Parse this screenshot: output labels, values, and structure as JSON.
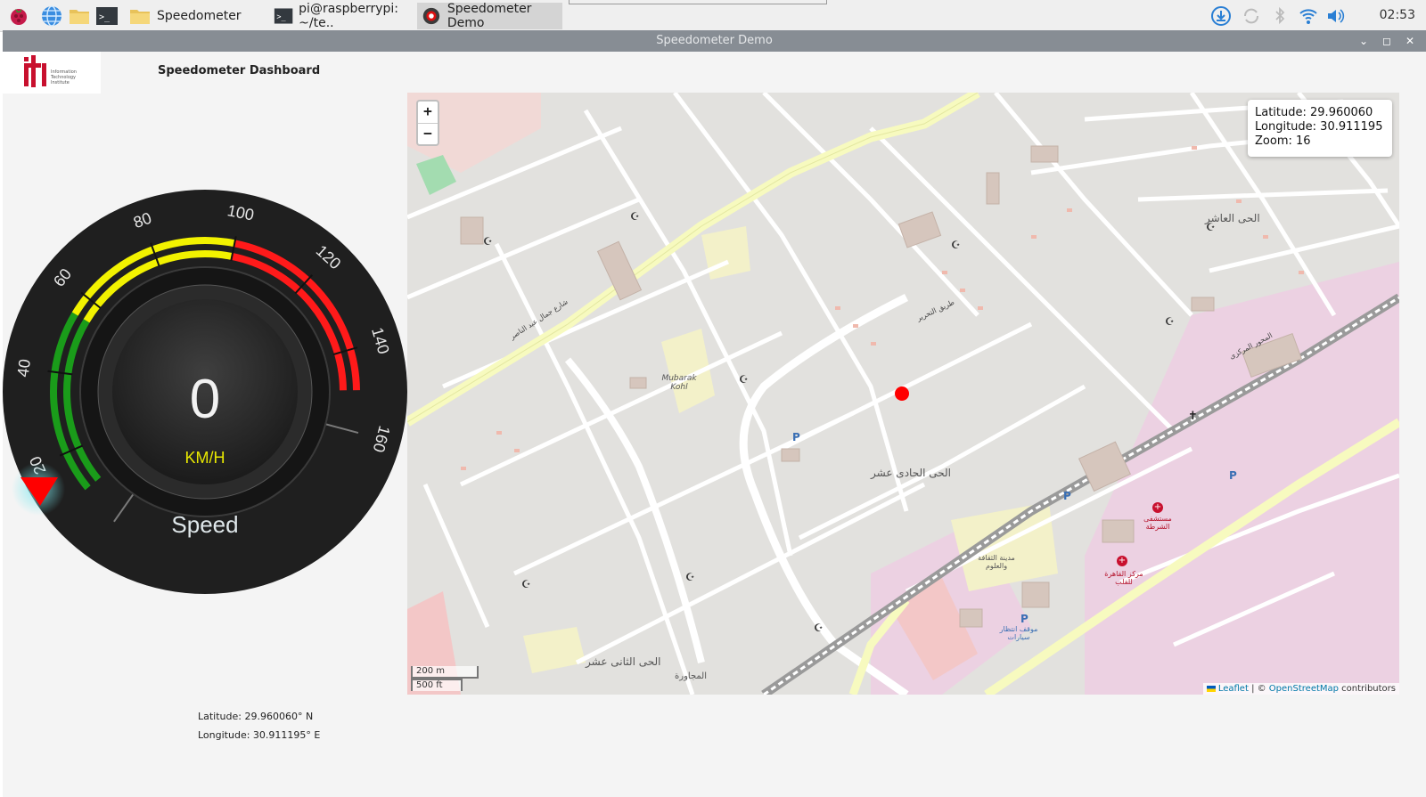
{
  "taskbar": {
    "tasks": [
      {
        "label": "Speedometer",
        "icon": "folder-icon"
      },
      {
        "label": "pi@raspberrypi: ~/te..",
        "icon": "terminal-icon"
      },
      {
        "label": "Speedometer Demo",
        "icon": "app-icon"
      }
    ],
    "clock": "02:53"
  },
  "window": {
    "title": "Speedometer Demo"
  },
  "app": {
    "title": "Speedometer Dashboard",
    "logo_text": "iti"
  },
  "gauge": {
    "value": "0",
    "unit": "KM/H",
    "label": "Speed",
    "ticks": [
      "20",
      "40",
      "60",
      "80",
      "100",
      "120",
      "140",
      "160"
    ],
    "colors": {
      "green": "#1a9c1a",
      "yellow": "#f2f200",
      "red": "#ff1a1a",
      "needle": "#ff0000",
      "face": "#262626"
    }
  },
  "map": {
    "zoom_in": "+",
    "zoom_out": "−",
    "info": {
      "latitude": "Latitude: 29.960060",
      "longitude": "Longitude: 30.911195",
      "zoom": "Zoom: 16"
    },
    "scale": {
      "metric": "200 m",
      "imperial": "500 ft"
    },
    "attribution": {
      "leaflet": "Leaflet",
      "sep": " | © ",
      "osm": "OpenStreetMap",
      "suffix": " contributors"
    },
    "labels": [
      {
        "text": "Mubarak Kohl",
        "key": "park"
      },
      {
        "text": "الحى الحادى عشر",
        "key": "district-11"
      },
      {
        "text": "الحى الثانى عشر",
        "key": "district-12"
      },
      {
        "text": "الحى العاشر",
        "key": "district-10"
      },
      {
        "text": "مدينة الثقافة والعلوم",
        "key": "culture-city"
      },
      {
        "text": "مستشفى الشرطة",
        "key": "police-hospital"
      },
      {
        "text": "مركز القاهرة للقلب",
        "key": "heart-center"
      },
      {
        "text": "موقف انتظار سيارات",
        "key": "parking"
      },
      {
        "text": "المجاورة",
        "key": "neighborhood"
      },
      {
        "text": "المحور المركزى",
        "key": "central-axis"
      },
      {
        "text": "شارع جمال عبد الناصر",
        "key": "nasser-st"
      },
      {
        "text": "طريق التحرير",
        "key": "tahrir-rd"
      }
    ]
  },
  "coords": {
    "latitude": "Latitude: 29.960060° N",
    "longitude": "Longitude: 30.911195° E"
  }
}
